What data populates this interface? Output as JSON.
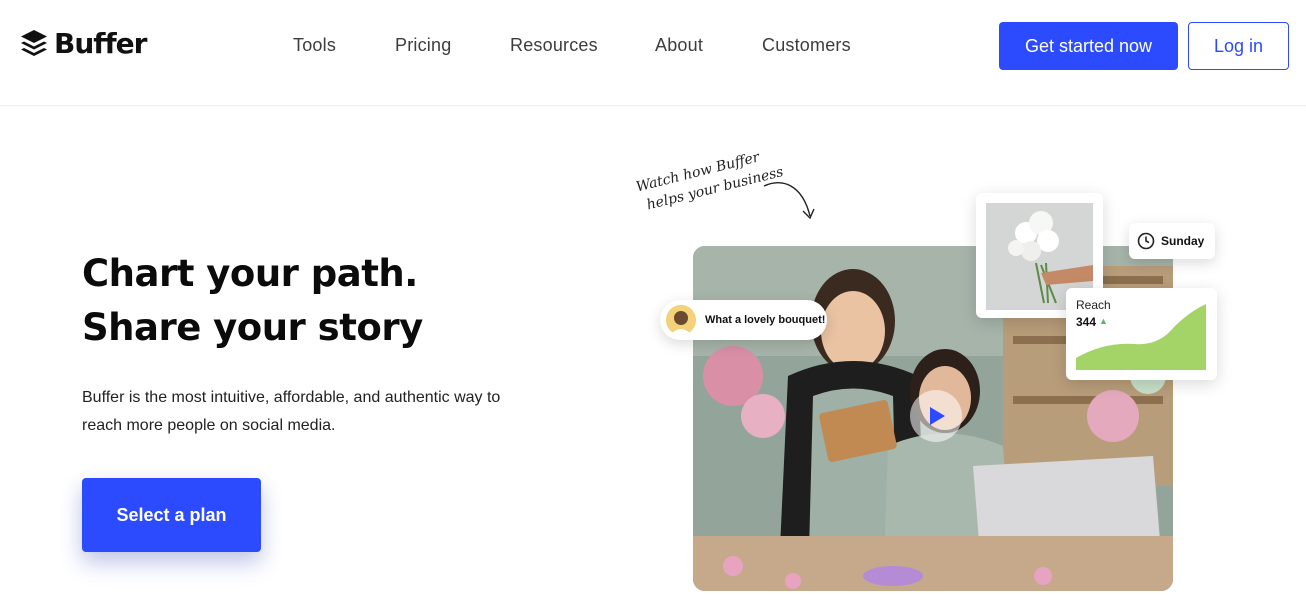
{
  "brand": {
    "name": "Buffer",
    "logo_icon": "buffer-stack-icon",
    "accent": "#2c4bff"
  },
  "nav": {
    "items": [
      {
        "label": "Tools"
      },
      {
        "label": "Pricing"
      },
      {
        "label": "Resources"
      },
      {
        "label": "About"
      },
      {
        "label": "Customers"
      }
    ],
    "get_started_label": "Get started now",
    "login_label": "Log in"
  },
  "hero": {
    "title_line1": "Chart your path.",
    "title_line2": "Share your story",
    "description": "Buffer is the most intuitive, affordable, and authentic way to reach more people on social media.",
    "cta_label": "Select a plan"
  },
  "visual": {
    "handwritten_line1": "Watch how Buffer",
    "handwritten_line2": "helps your business",
    "comment_text": "What a lovely bouquet!",
    "schedule_day": "Sunday",
    "reach_label": "Reach",
    "reach_value": "344",
    "reach_trend_icon": "up-triangle-icon",
    "play_icon": "play-icon",
    "clock_icon": "clock-icon"
  }
}
